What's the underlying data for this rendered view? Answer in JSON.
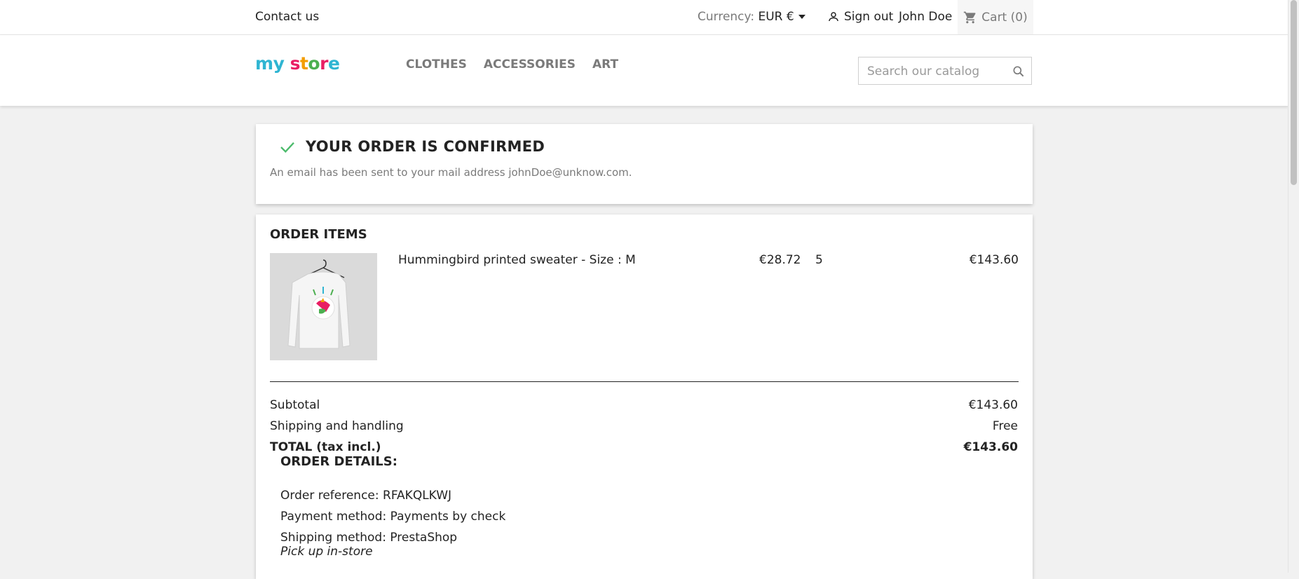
{
  "topbar": {
    "contact": "Contact us",
    "currency_label": "Currency:",
    "currency_value": "EUR €",
    "sign_out": "Sign out",
    "user_name": "John Doe",
    "cart": "Cart (0)"
  },
  "header": {
    "logo": [
      "m",
      "y",
      " ",
      "s",
      "t",
      "o",
      "r",
      "e"
    ],
    "logo_colors": [
      "#2fb5d2",
      "#2fb5d2",
      "",
      "#e91e63",
      "#f39d00",
      "#4caf50",
      "#e91e63",
      "#2fb5d2"
    ],
    "nav": [
      "CLOTHES",
      "ACCESSORIES",
      "ART"
    ],
    "search_placeholder": "Search our catalog"
  },
  "confirmation": {
    "title": "YOUR ORDER IS CONFIRMED",
    "email_text": "An email has been sent to your mail address johnDoe@unknow.com."
  },
  "order_items": {
    "title": "ORDER ITEMS",
    "items": [
      {
        "name": "Hummingbird printed sweater - Size : M",
        "unit_price": "€28.72",
        "quantity": "5",
        "total": "€143.60"
      }
    ],
    "subtotal_label": "Subtotal",
    "subtotal_value": "€143.60",
    "shipping_label": "Shipping and handling",
    "shipping_value": "Free",
    "total_label": "TOTAL (tax incl.)",
    "total_value": "€143.60"
  },
  "order_details": {
    "title": "ORDER DETAILS:",
    "reference": "Order reference: RFAKQLKWJ",
    "payment": "Payment method: Payments by check",
    "shipping": "Shipping method: PrestaShop",
    "carrier_note": "Pick up in-store"
  },
  "colors": {
    "check": "#4cbb6c",
    "accent": "#2fb5d2"
  }
}
